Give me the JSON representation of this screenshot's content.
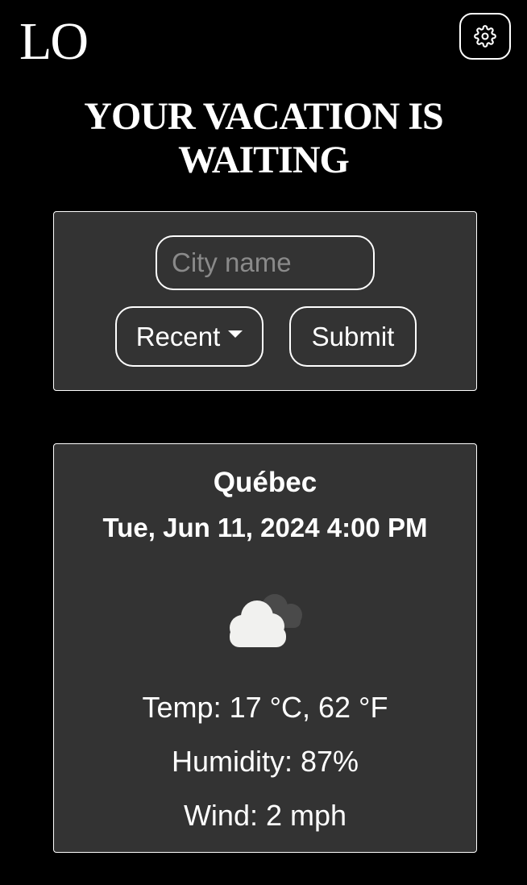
{
  "header": {
    "logo": "LO",
    "settings_icon": "gear-icon"
  },
  "headline": {
    "line1": "YOUR VACATION IS",
    "line2": "WAITING"
  },
  "search": {
    "city_placeholder": "City name",
    "recent_label": "Recent",
    "recent_icon": "caret-down-icon",
    "submit_label": "Submit"
  },
  "weather": {
    "city": "Québec",
    "datetime": "Tue, Jun 11, 2024 4:00 PM",
    "icon": "broken-clouds-icon",
    "temp": "Temp: 17 °C, 62 °F",
    "humidity": "Humidity: 87%",
    "wind": "Wind: 2 mph"
  },
  "colors": {
    "background": "#000000",
    "card": "#333333",
    "text": "#ffffff",
    "placeholder": "#8a8a8a",
    "cloud_front": "#f1f1ef",
    "cloud_back": "#4a4a4a"
  }
}
